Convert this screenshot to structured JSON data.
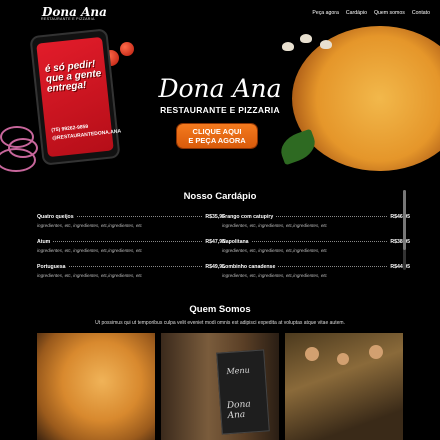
{
  "header": {
    "logo_name": "Dona Ana",
    "logo_sub": "RESTAURANTE E PIZZARIA",
    "nav": [
      "Peça agora",
      "Cardápio",
      "Quem somos",
      "Contato"
    ]
  },
  "hero": {
    "phone_slogan": "é só pedir! que a gente entrega!",
    "phone_phone": "(75) 99262-9859",
    "phone_instagram": "@RESTAURANTEDONA.ANA",
    "brand_name": "Dona Ana",
    "brand_sub": "RESTAURANTE E PIZZARIA",
    "cta_line1": "CLIQUE AQUI",
    "cta_line2": "E PEÇA AGORA"
  },
  "menu": {
    "title": "Nosso Cardápio",
    "left": [
      {
        "name": "Quatro queijos",
        "price": "R$35,95",
        "desc": "ingredientes, etc, ingredientes, etc,ingredientes, etc"
      },
      {
        "name": "Atum",
        "price": "R$47,95",
        "desc": "ingredientes, etc, ingredientes, etc,ingredientes, etc"
      },
      {
        "name": "Portuguesa",
        "price": "R$49,95",
        "desc": "ingredientes, etc, ingredientes, etc,ingredientes, etc"
      }
    ],
    "right": [
      {
        "name": "Frango com catupiry",
        "price": "R$46,95",
        "desc": "ingredientes, etc, ingredientes, etc,ingredientes, etc"
      },
      {
        "name": "Napolitana",
        "price": "R$38,95",
        "desc": "ingredientes, etc, ingredientes, etc,ingredientes, etc"
      },
      {
        "name": "Lombinho canadense",
        "price": "R$44,95",
        "desc": "ingredientes, etc, ingredientes, etc,ingredientes, etc"
      }
    ]
  },
  "about": {
    "title": "Quem Somos",
    "text": "Ut possimus qui ut temporibus culpa velit eveniet modi omnis est adipisci expedita at voluptas atque vitae autem.",
    "menu_board_title": "Menu",
    "menu_board_name": "Dona Ana"
  },
  "colors": {
    "background": "#000000",
    "accent_orange": "#f47a1e",
    "phone_red": "#e21c2a"
  }
}
